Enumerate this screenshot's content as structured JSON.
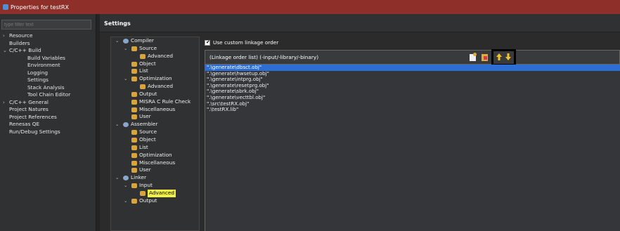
{
  "window": {
    "title": "Properties for testRX"
  },
  "filter": {
    "placeholder": "type filter text"
  },
  "nav": [
    {
      "label": "Resource",
      "level": 1,
      "twisty": ">"
    },
    {
      "label": "Builders",
      "level": 1,
      "twisty": ""
    },
    {
      "label": "C/C++ Build",
      "level": 1,
      "twisty": "v"
    },
    {
      "label": "Build Variables",
      "level": 2,
      "twisty": ""
    },
    {
      "label": "Environment",
      "level": 2,
      "twisty": ""
    },
    {
      "label": "Logging",
      "level": 2,
      "twisty": ""
    },
    {
      "label": "Settings",
      "level": 2,
      "twisty": ""
    },
    {
      "label": "Stack Analysis",
      "level": 2,
      "twisty": ""
    },
    {
      "label": "Tool Chain Editor",
      "level": 2,
      "twisty": ""
    },
    {
      "label": "C/C++ General",
      "level": 1,
      "twisty": ">"
    },
    {
      "label": "Project Natures",
      "level": 1,
      "twisty": ""
    },
    {
      "label": "Project References",
      "level": 1,
      "twisty": ""
    },
    {
      "label": "Renesas QE",
      "level": 1,
      "twisty": ""
    },
    {
      "label": "Run/Debug Settings",
      "level": 1,
      "twisty": ""
    }
  ],
  "settings": {
    "title": "Settings"
  },
  "tree": [
    {
      "label": "Compiler",
      "depth": 0,
      "twisty": "v",
      "icon": "gear"
    },
    {
      "label": "Source",
      "depth": 1,
      "twisty": "v",
      "icon": "tool"
    },
    {
      "label": "Advanced",
      "depth": 2,
      "twisty": "",
      "icon": "tool"
    },
    {
      "label": "Object",
      "depth": 1,
      "twisty": "",
      "icon": "tool"
    },
    {
      "label": "List",
      "depth": 1,
      "twisty": "",
      "icon": "tool"
    },
    {
      "label": "Optimization",
      "depth": 1,
      "twisty": "v",
      "icon": "tool"
    },
    {
      "label": "Advanced",
      "depth": 2,
      "twisty": "",
      "icon": "tool"
    },
    {
      "label": "Output",
      "depth": 1,
      "twisty": "",
      "icon": "tool"
    },
    {
      "label": "MISRA C Rule Check",
      "depth": 1,
      "twisty": "",
      "icon": "tool"
    },
    {
      "label": "Miscellaneous",
      "depth": 1,
      "twisty": "",
      "icon": "tool"
    },
    {
      "label": "User",
      "depth": 1,
      "twisty": "",
      "icon": "tool"
    },
    {
      "label": "Assembler",
      "depth": 0,
      "twisty": "v",
      "icon": "gear"
    },
    {
      "label": "Source",
      "depth": 1,
      "twisty": "",
      "icon": "tool"
    },
    {
      "label": "Object",
      "depth": 1,
      "twisty": "",
      "icon": "tool"
    },
    {
      "label": "List",
      "depth": 1,
      "twisty": "",
      "icon": "tool"
    },
    {
      "label": "Optimization",
      "depth": 1,
      "twisty": "",
      "icon": "tool"
    },
    {
      "label": "Miscellaneous",
      "depth": 1,
      "twisty": "",
      "icon": "tool"
    },
    {
      "label": "User",
      "depth": 1,
      "twisty": "",
      "icon": "tool"
    },
    {
      "label": "Linker",
      "depth": 0,
      "twisty": "v",
      "icon": "gear"
    },
    {
      "label": "Input",
      "depth": 1,
      "twisty": "v",
      "icon": "tool"
    },
    {
      "label": "Advanced",
      "depth": 2,
      "twisty": "",
      "icon": "tool",
      "selected": true
    },
    {
      "label": "Output",
      "depth": 1,
      "twisty": "v",
      "icon": "tool"
    }
  ],
  "linkage": {
    "checkbox_label": "Use custom linkage order",
    "checked": true,
    "list_header": "(Linkage order list) (-input/-library/-binary)",
    "items": [
      "\".\\generate\\dbsct.obj\"",
      "\".\\generate\\hwsetup.obj\"",
      "\".\\generate\\intprg.obj\"",
      "\".\\generate\\resetprg.obj\"",
      "\".\\generate\\sbrk.obj\"",
      "\".\\generate\\vecttbl.obj\"",
      "\".\\src\\testRX.obj\"",
      "\".\\testRX.lib\""
    ],
    "selected_index": 0
  },
  "toolbar": {
    "add_icon": "add-item-icon",
    "delete_icon": "delete-item-icon",
    "up_icon": "move-up-icon",
    "down_icon": "move-down-icon"
  },
  "colors": {
    "titlebar": "#8e2f2a",
    "selection": "#2d6ed4",
    "tree_selection": "#f0f046",
    "arrow": "#f2c12e"
  }
}
